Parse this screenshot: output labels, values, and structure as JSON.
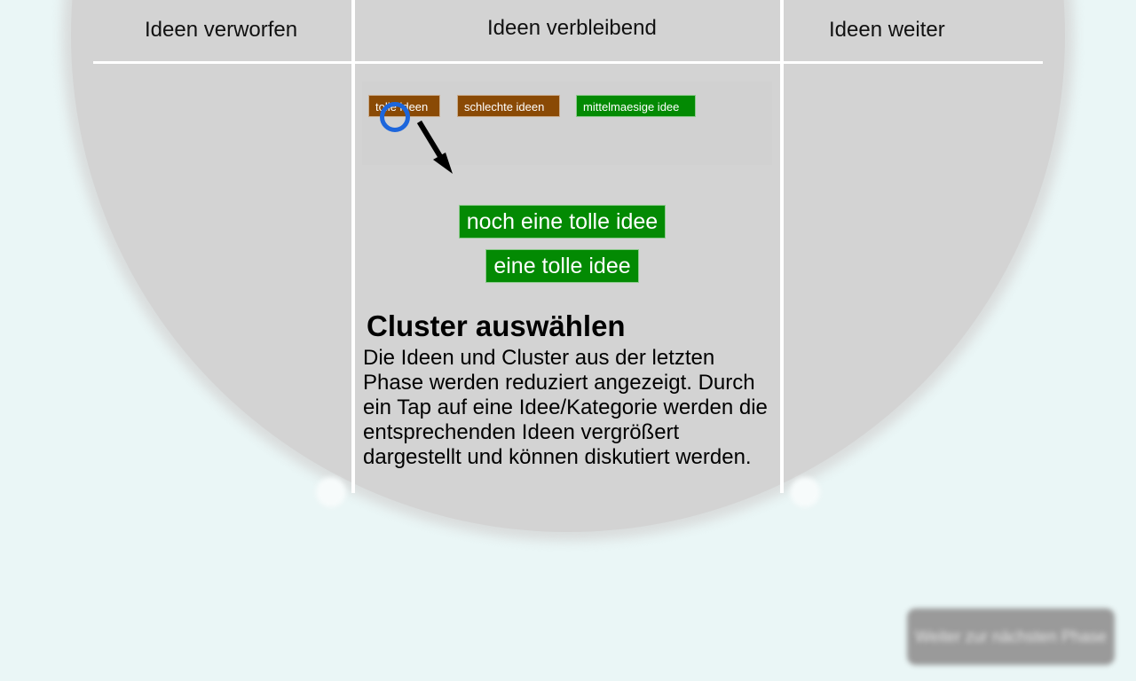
{
  "columns": {
    "left": "Ideen verworfen",
    "middle": "Ideen verbleibend",
    "right": "Ideen weiter"
  },
  "categories": [
    {
      "label": "tolle ideen",
      "color": "#8a4a05"
    },
    {
      "label": "schlechte ideen",
      "color": "#8a4a05"
    },
    {
      "label": "mittelmaesige idee",
      "color": "#038a03"
    }
  ],
  "ideas": [
    {
      "label": "noch eine tolle idee",
      "color": "#038a03"
    },
    {
      "label": "eine tolle idee",
      "color": "#038a03"
    }
  ],
  "help": {
    "title": "Cluster auswählen",
    "text": "Die Ideen und Cluster aus der letzten Phase werden reduziert angezeigt. Durch ein Tap auf eine Idee/Kategorie werden die entsprechenden Ideen vergrößert dargestellt und können diskutiert werden."
  },
  "continue_button": {
    "label": "Weiter zur nächsten Phase"
  },
  "icons": {
    "tap_indicator": "tap-circle-icon",
    "hint_arrow": "arrow-down-right-icon"
  },
  "colors": {
    "background": "#eaf6f6",
    "disc": "#d3d3d3",
    "tap_ring": "#1d66dc"
  }
}
